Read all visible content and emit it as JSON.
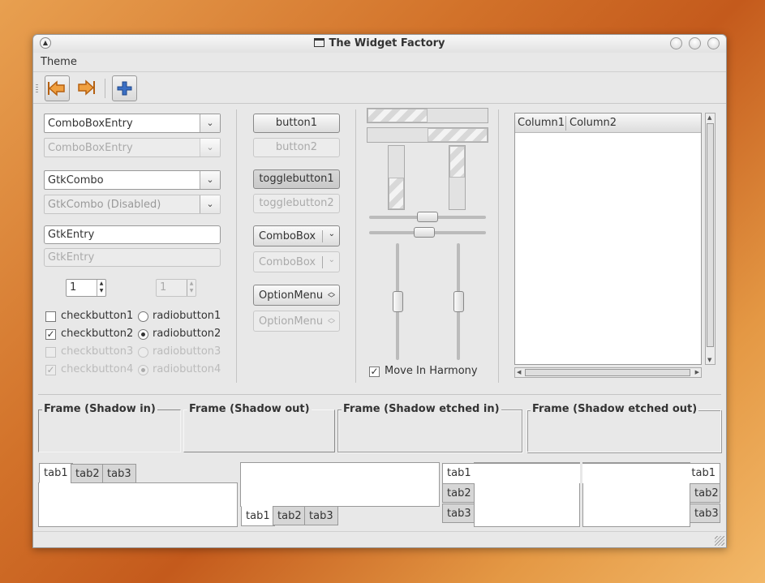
{
  "window": {
    "title": "The Widget Factory"
  },
  "menubar": {
    "items": [
      "Theme"
    ]
  },
  "toolbar": {
    "buttons": [
      {
        "name": "back",
        "icon": "arrow-left-icon"
      },
      {
        "name": "forward",
        "icon": "arrow-right-icon"
      },
      {
        "name": "add",
        "icon": "plus-icon"
      }
    ]
  },
  "left": {
    "combo_entry_1": "ComboBoxEntry",
    "combo_entry_2": "ComboBoxEntry",
    "gtk_combo_1": "GtkCombo",
    "gtk_combo_2": "GtkCombo (Disabled)",
    "entry_1": "GtkEntry",
    "entry_2": "GtkEntry",
    "spin_1": "1",
    "spin_2": "1",
    "checks": [
      "checkbutton1",
      "checkbutton2",
      "checkbutton3",
      "checkbutton4"
    ],
    "radios": [
      "radiobutton1",
      "radiobutton2",
      "radiobutton3",
      "radiobutton4"
    ]
  },
  "buttons": {
    "button1": "button1",
    "button2": "button2",
    "toggle1": "togglebutton1",
    "toggle2": "togglebutton2",
    "combo1": "ComboBox",
    "combo2": "ComboBox",
    "option1": "OptionMenu",
    "option2": "OptionMenu"
  },
  "sliders": {
    "progress_h1": 0.5,
    "progress_h2": 0.5,
    "progress_v1": 0.5,
    "progress_v2": 0.5,
    "scale_h1": 0.5,
    "scale_h2": 0.5,
    "scale_v1": 0.5,
    "scale_v2": 0.5,
    "harmony_label": "Move In Harmony"
  },
  "tree": {
    "columns": [
      "Column1",
      "Column2"
    ]
  },
  "frames": [
    "Frame (Shadow in)",
    "Frame (Shadow out)",
    "Frame (Shadow etched in)",
    "Frame (Shadow etched out)"
  ],
  "notebooks": {
    "tabs": [
      "tab1",
      "tab2",
      "tab3"
    ]
  },
  "colors": {
    "accent": "#e08a28",
    "desktop": "#d2722a"
  }
}
